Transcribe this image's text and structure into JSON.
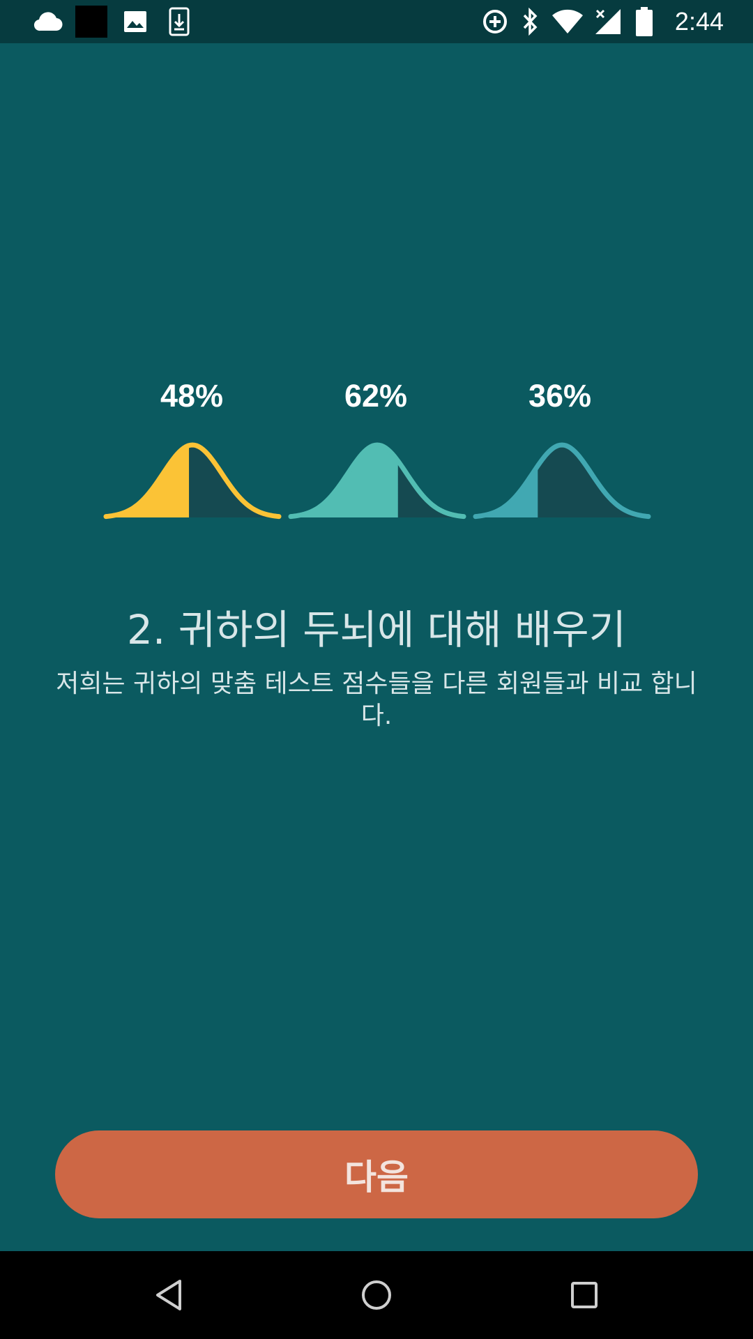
{
  "status_bar": {
    "time": "2:44",
    "left_icons": [
      "cloud-icon",
      "black-square-icon",
      "image-icon",
      "download-icon"
    ],
    "right_icons": [
      "data-saver-icon",
      "bluetooth-icon",
      "wifi-icon",
      "signal-icon",
      "battery-icon"
    ]
  },
  "graphs": {
    "items": [
      {
        "percent_label": "48%",
        "value": 0.48,
        "color": "#fbc336"
      },
      {
        "percent_label": "62%",
        "value": 0.62,
        "color": "#52bdb3"
      },
      {
        "percent_label": "36%",
        "value": 0.36,
        "color": "#41a8b2"
      }
    ],
    "shadow_color": "#154a51"
  },
  "content": {
    "title": "2. 귀하의 두뇌에 대해 배우기",
    "subtitle": "저희는 귀하의 맞춤 테스트 점수들을 다른 회원들과 비교 합니다."
  },
  "actions": {
    "next_label": "다음",
    "next_color": "#cd6745"
  },
  "nav_bar": {
    "buttons": [
      "back-icon",
      "home-icon",
      "recents-icon"
    ]
  }
}
